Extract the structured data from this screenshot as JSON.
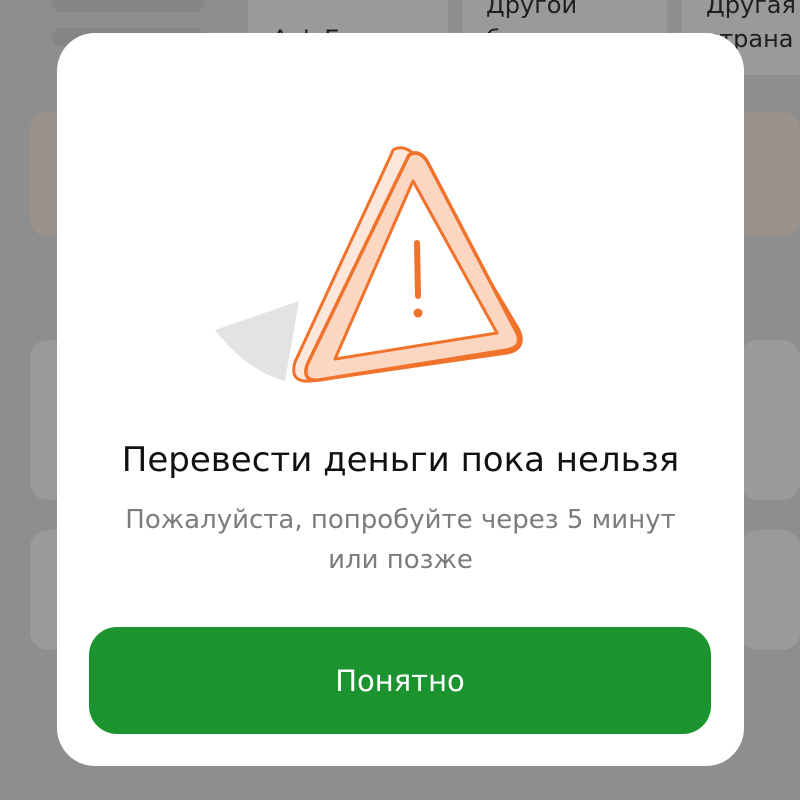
{
  "background": {
    "tile_1_label_line1": "Другой",
    "tile_1_label_line2": "б",
    "tile_2_label_line1": "Другая",
    "tile_2_label_line2": "страна",
    "tile_0_label_partial": "А   ф Б"
  },
  "dialog": {
    "icon": "warning-triangle-icon",
    "title": "Перевести деньги пока нельзя",
    "message_line1": "Пожалуйста, попробуйте через 5 минут",
    "message_line2": "или позже",
    "confirm_label": "Понятно"
  },
  "colors": {
    "accent_green": "#1b932f",
    "warning_orange": "#f0722b",
    "overlay": "#8e8e8e"
  }
}
